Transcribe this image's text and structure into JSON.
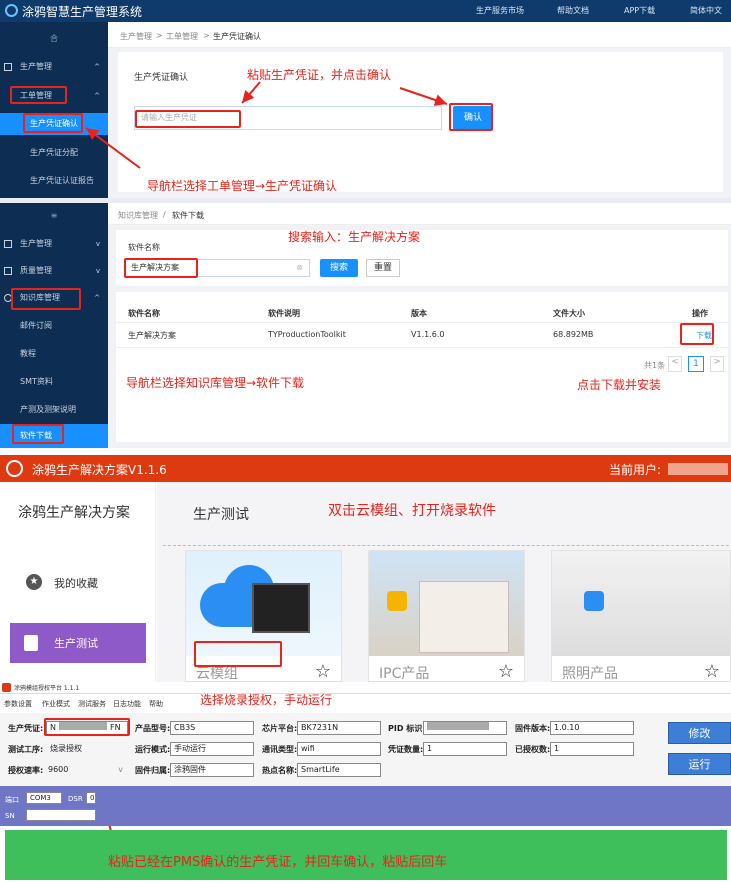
{
  "app": {
    "title": "涂鸦智慧生产管理系统"
  },
  "topbar": {
    "menu": [
      "生产服务市场",
      "帮助文档",
      "APP下载",
      "简体中文"
    ]
  },
  "section1": {
    "sidebar": {
      "group_collapsed": "合",
      "items": [
        "生产管理",
        "工单管理",
        "生产凭证确认",
        "生产凭证分配",
        "生产凭证认证报告"
      ]
    },
    "breadcrumb": [
      "生产管理",
      "工单管理",
      "生产凭证确认"
    ],
    "label": "生产凭证确认",
    "input_placeholder": "请输入生产凭证",
    "confirm_button": "确认",
    "annotations": {
      "paste": "粘贴生产凭证，并点击确认",
      "nav": "导航栏选择工单管理→生产凭证确认"
    }
  },
  "section2": {
    "sidebar": {
      "group_collapsed": "≡",
      "items": [
        "生产管理",
        "质量管理",
        "知识库管理",
        "邮件订阅",
        "教程",
        "SMT资料",
        "产测及测架说明",
        "软件下载"
      ]
    },
    "breadcrumb": [
      "知识库管理",
      "软件下载"
    ],
    "search_label": "软件名称",
    "search_value": "生产解决方案",
    "search_button": "搜索",
    "reset_button": "重置",
    "table": {
      "headers": [
        "软件名称",
        "软件说明",
        "版本",
        "文件大小",
        "操作"
      ],
      "rows": [
        [
          "生产解决方案",
          "TYProductionToolkit",
          "V1.1.6.0",
          "68.892MB",
          "下载"
        ]
      ]
    },
    "pagination": {
      "total": "共1条",
      "page": "1"
    },
    "annotations": {
      "search": "搜索输入：生产解决方案",
      "nav": "导航栏选择知识库管理→软件下载",
      "download": "点击下载并安装"
    }
  },
  "section3": {
    "title": "涂鸦生产解决方案V1.1.6",
    "user_label": "当前用户:",
    "side_title": "涂鸦生产解决方案",
    "nav": [
      "我的收藏",
      "生产测试"
    ],
    "main_title": "生产测试",
    "cards": [
      "云模组",
      "IPC产品",
      "照明产品"
    ],
    "annotation": "双击云模组、打开烧录软件"
  },
  "section4": {
    "title": "涂鸦模组授权平台 1.1.1",
    "menu": [
      "参数设置",
      "作业模式",
      "测试服务",
      "日志功能",
      "帮助"
    ],
    "fields": {
      "cred_label": "生产凭证:",
      "cred_value_start": "N",
      "cred_value_end": "FN",
      "model_label": "产品型号:",
      "model_value": "CB3S",
      "chip_label": "芯片平台:",
      "chip_value": "BK7231N",
      "pid_label": "PID 标识:",
      "fw_ver_label": "固件版本:",
      "fw_ver_value": "1.0.10",
      "step_label": "测试工序:",
      "step_value": "烧录授权",
      "mode_label": "运行模式:",
      "mode_value": "手动运行",
      "comm_label": "通讯类型:",
      "comm_value": "wifi",
      "cred_count_label": "凭证数量:",
      "cred_count_value": "1",
      "authed_label": "已授权数:",
      "authed_value": "1",
      "rate_label": "授权速率:",
      "rate_value": "9600",
      "fw_owner_label": "固件归属:",
      "fw_owner_value": "涂鸦固件",
      "hotspot_label": "热点名称:",
      "hotspot_value": "SmartLife"
    },
    "buttons": {
      "modify": "修改",
      "run": "运行"
    },
    "port": {
      "label": "端口",
      "value": "COM3",
      "dsr_label": "DSR",
      "dsr_value": "0",
      "sn_label": "SN"
    },
    "annotations": {
      "select": "选择烧录授权，手动运行",
      "paste": "粘贴已经在PMS确认的生产凭证，并回车确认，粘贴后回车"
    }
  },
  "colors": {
    "navy": "#0e2d52",
    "blue": "#1890ff",
    "red": "#e8231b",
    "orange": "#dd3a12",
    "purple": "#8e5ac8",
    "green": "#3ebf5b",
    "port_bar": "#6f76c6"
  }
}
